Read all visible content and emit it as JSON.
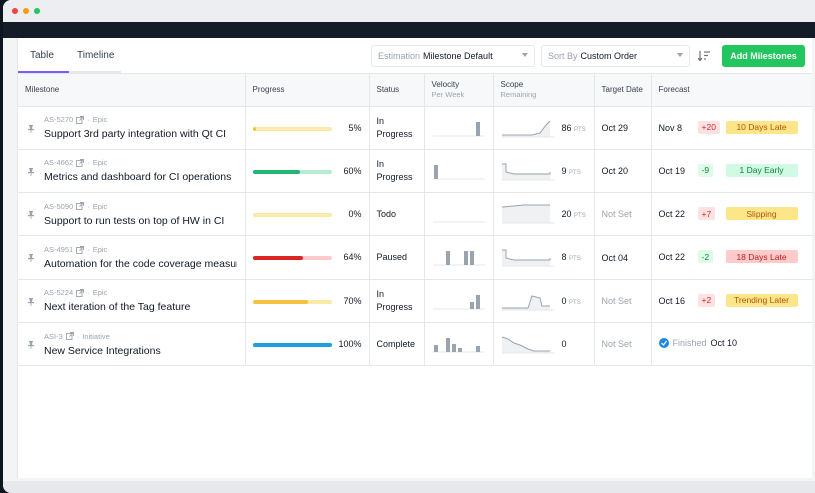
{
  "colors": {
    "accent": "#22c55e",
    "tab_active": "#7c5cff",
    "dot_red": "#ef4444",
    "dot_yellow": "#f59e0b",
    "dot_green": "#22c55e"
  },
  "tabs": [
    {
      "label": "Table",
      "active": true
    },
    {
      "label": "Timeline",
      "active": false
    }
  ],
  "controls": {
    "estimation_label": "Estimation",
    "estimation_value": "Milestone Default",
    "sort_label": "Sort By",
    "sort_value": "Custom Order",
    "add_button": "Add Milestones"
  },
  "columns": {
    "milestone": "Milestone",
    "progress": "Progress",
    "status": "Status",
    "velocity": "Velocity",
    "velocity_sub": "Per Week",
    "scope": "Scope",
    "scope_sub": "Remaining",
    "target_date": "Target Date",
    "forecast": "Forecast"
  },
  "rows": [
    {
      "id": "AS-5270",
      "type": "Epic",
      "title": "Support 3rd party integration with Qt CI",
      "progress_pct": "5%",
      "progress_fraction": 0.05,
      "bar_color": "#f5c242",
      "bar_bg": "#fbe9a8",
      "status": "In Progress",
      "velocity_bars": [
        0,
        0,
        0,
        0,
        0,
        0,
        0,
        1
      ],
      "scope_line": "rising_end",
      "scope_pts": "86",
      "pts_unit": "PTS",
      "target_date": "Oct 29",
      "target_set": true,
      "forecast_date": "Nov 8",
      "delta": "+20",
      "delta_color": "#dc2626",
      "delta_bg": "#fee2e2",
      "badge": "10 Days Late",
      "badge_color": "#b45309",
      "badge_bg": "#fde68a"
    },
    {
      "id": "AS-4662",
      "type": "Epic",
      "title": "Metrics and dashboard for CI operations",
      "progress_pct": "60%",
      "progress_fraction": 0.6,
      "bar_color": "#22b573",
      "bar_bg": "#b6ecd2",
      "status": "In Progress",
      "velocity_bars": [
        1,
        0,
        0,
        0,
        0,
        0,
        0,
        0
      ],
      "scope_line": "drop_start",
      "scope_pts": "9",
      "pts_unit": "PTS",
      "target_date": "Oct 20",
      "target_set": true,
      "forecast_date": "Oct 19",
      "delta": "-9",
      "delta_color": "#15803d",
      "delta_bg": "#dcfce7",
      "badge": "1 Day Early",
      "badge_color": "#15803d",
      "badge_bg": "#d1fae5"
    },
    {
      "id": "AS-5090",
      "type": "Epic",
      "title": "Support to run tests on top of HW in CI",
      "progress_pct": "0%",
      "progress_fraction": 0,
      "bar_color": "#f5c242",
      "bar_bg": "#fbe9a8",
      "status": "Todo",
      "velocity_bars": [
        0,
        0,
        0,
        0,
        0,
        0,
        0,
        0
      ],
      "scope_line": "flat_high",
      "scope_pts": "20",
      "pts_unit": "PTS",
      "target_date": "Not Set",
      "target_set": false,
      "forecast_date": "Oct 22",
      "delta": "+7",
      "delta_color": "#dc2626",
      "delta_bg": "#fee2e2",
      "badge": "Slipping",
      "badge_color": "#b45309",
      "badge_bg": "#fde68a"
    },
    {
      "id": "AS-4951",
      "type": "Epic",
      "title": "Automation for the code coverage measurement",
      "progress_pct": "64%",
      "progress_fraction": 0.64,
      "bar_color": "#dc2626",
      "bar_bg": "#fecaca",
      "status": "Paused",
      "velocity_bars": [
        0,
        0,
        1,
        0,
        0,
        1,
        1,
        0
      ],
      "scope_line": "drop_start",
      "scope_pts": "8",
      "pts_unit": "PTS",
      "target_date": "Oct 04",
      "target_set": true,
      "forecast_date": "Oct 22",
      "delta": "-2",
      "delta_color": "#15803d",
      "delta_bg": "#dcfce7",
      "badge": "18 Days Late",
      "badge_color": "#b91c1c",
      "badge_bg": "#fecaca"
    },
    {
      "id": "AS-5224",
      "type": "Epic",
      "title": "Next iteration of the Tag feature",
      "progress_pct": "70%",
      "progress_fraction": 0.7,
      "bar_color": "#f5c242",
      "bar_bg": "#fbe9a8",
      "status": "In Progress",
      "velocity_bars": [
        0,
        0,
        0,
        0,
        0,
        0,
        0.5,
        1
      ],
      "scope_line": "bump",
      "scope_pts": "0",
      "pts_unit": "PTS",
      "target_date": "Not Set",
      "target_set": false,
      "forecast_date": "Oct 16",
      "delta": "+2",
      "delta_color": "#dc2626",
      "delta_bg": "#fee2e2",
      "badge": "Trending Later",
      "badge_color": "#b45309",
      "badge_bg": "#fde68a"
    },
    {
      "id": "ASI-3",
      "type": "Initiative",
      "title": "New Service Integrations",
      "progress_pct": "100%",
      "progress_fraction": 1,
      "bar_color": "#1ea0dc",
      "bar_bg": "#bae6fd",
      "status": "Complete",
      "velocity_bars": [
        0.5,
        0,
        1,
        0.6,
        0.3,
        0,
        0,
        0.4
      ],
      "scope_line": "descending",
      "scope_pts": "0",
      "pts_unit": "",
      "target_date": "Not Set",
      "target_set": false,
      "finished": true,
      "finished_label": "Finished",
      "forecast_date": "Oct 10"
    }
  ]
}
